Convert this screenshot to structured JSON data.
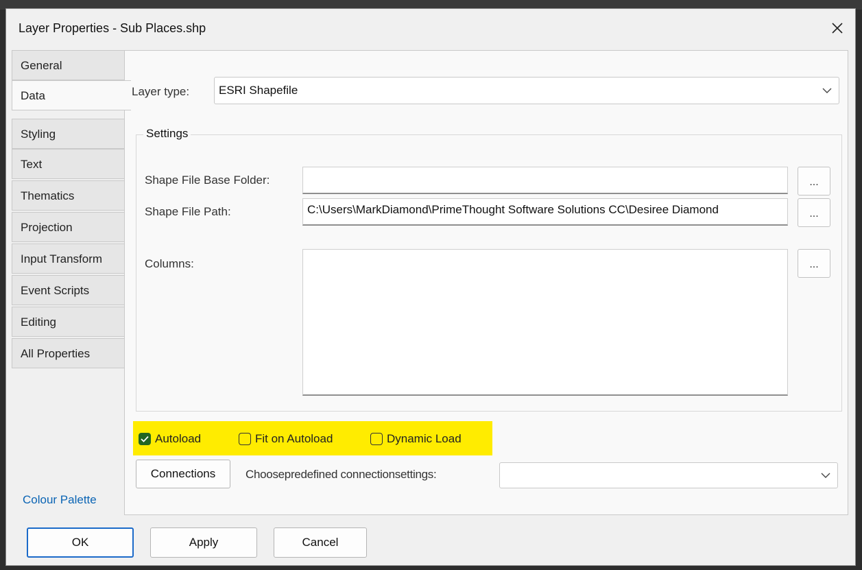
{
  "window": {
    "title": "Layer Properties - Sub Places.shp",
    "close_icon": "close-icon"
  },
  "tabs": [
    {
      "label": "General",
      "active": false
    },
    {
      "label": "Data",
      "active": true
    },
    {
      "label": "Styling",
      "active": false
    },
    {
      "label": "Text",
      "active": false
    },
    {
      "label": "Thematics",
      "active": false
    },
    {
      "label": "Projection",
      "active": false
    },
    {
      "label": "Input Transform",
      "active": false
    },
    {
      "label": "Event Scripts",
      "active": false
    },
    {
      "label": "Editing",
      "active": false
    },
    {
      "label": "All Properties",
      "active": false
    }
  ],
  "data_panel": {
    "layer_type_label": "Layer type:",
    "layer_type_value": "ESRI Shapefile",
    "settings_title": "Settings",
    "base_folder_label": "Shape File Base Folder:",
    "base_folder_value": "",
    "base_folder_button": "...",
    "path_label": "Shape File Path:",
    "path_value": "C:\\Users\\MarkDiamond\\PrimeThought Software Solutions CC\\Desiree Diamond",
    "path_button": "...",
    "columns_label": "Columns:",
    "columns_value": "",
    "columns_button": "...",
    "autoload_label": "Autoload",
    "autoload_checked": true,
    "fit_label": "Fit on Autoload",
    "fit_checked": false,
    "dynamic_label": "Dynamic Load",
    "dynamic_checked": false,
    "highlight_color": "#ffec00",
    "connections_button": "Connections",
    "predefined_label": "Choosepredefined connectionsettings:",
    "predefined_value": ""
  },
  "footer": {
    "colour_palette_link": "Colour Palette",
    "ok_label": "OK",
    "apply_label": "Apply",
    "cancel_label": "Cancel"
  },
  "colors": {
    "accent": "#1b6ac9",
    "link": "#0a64b4",
    "checkbox_on": "#226622"
  }
}
